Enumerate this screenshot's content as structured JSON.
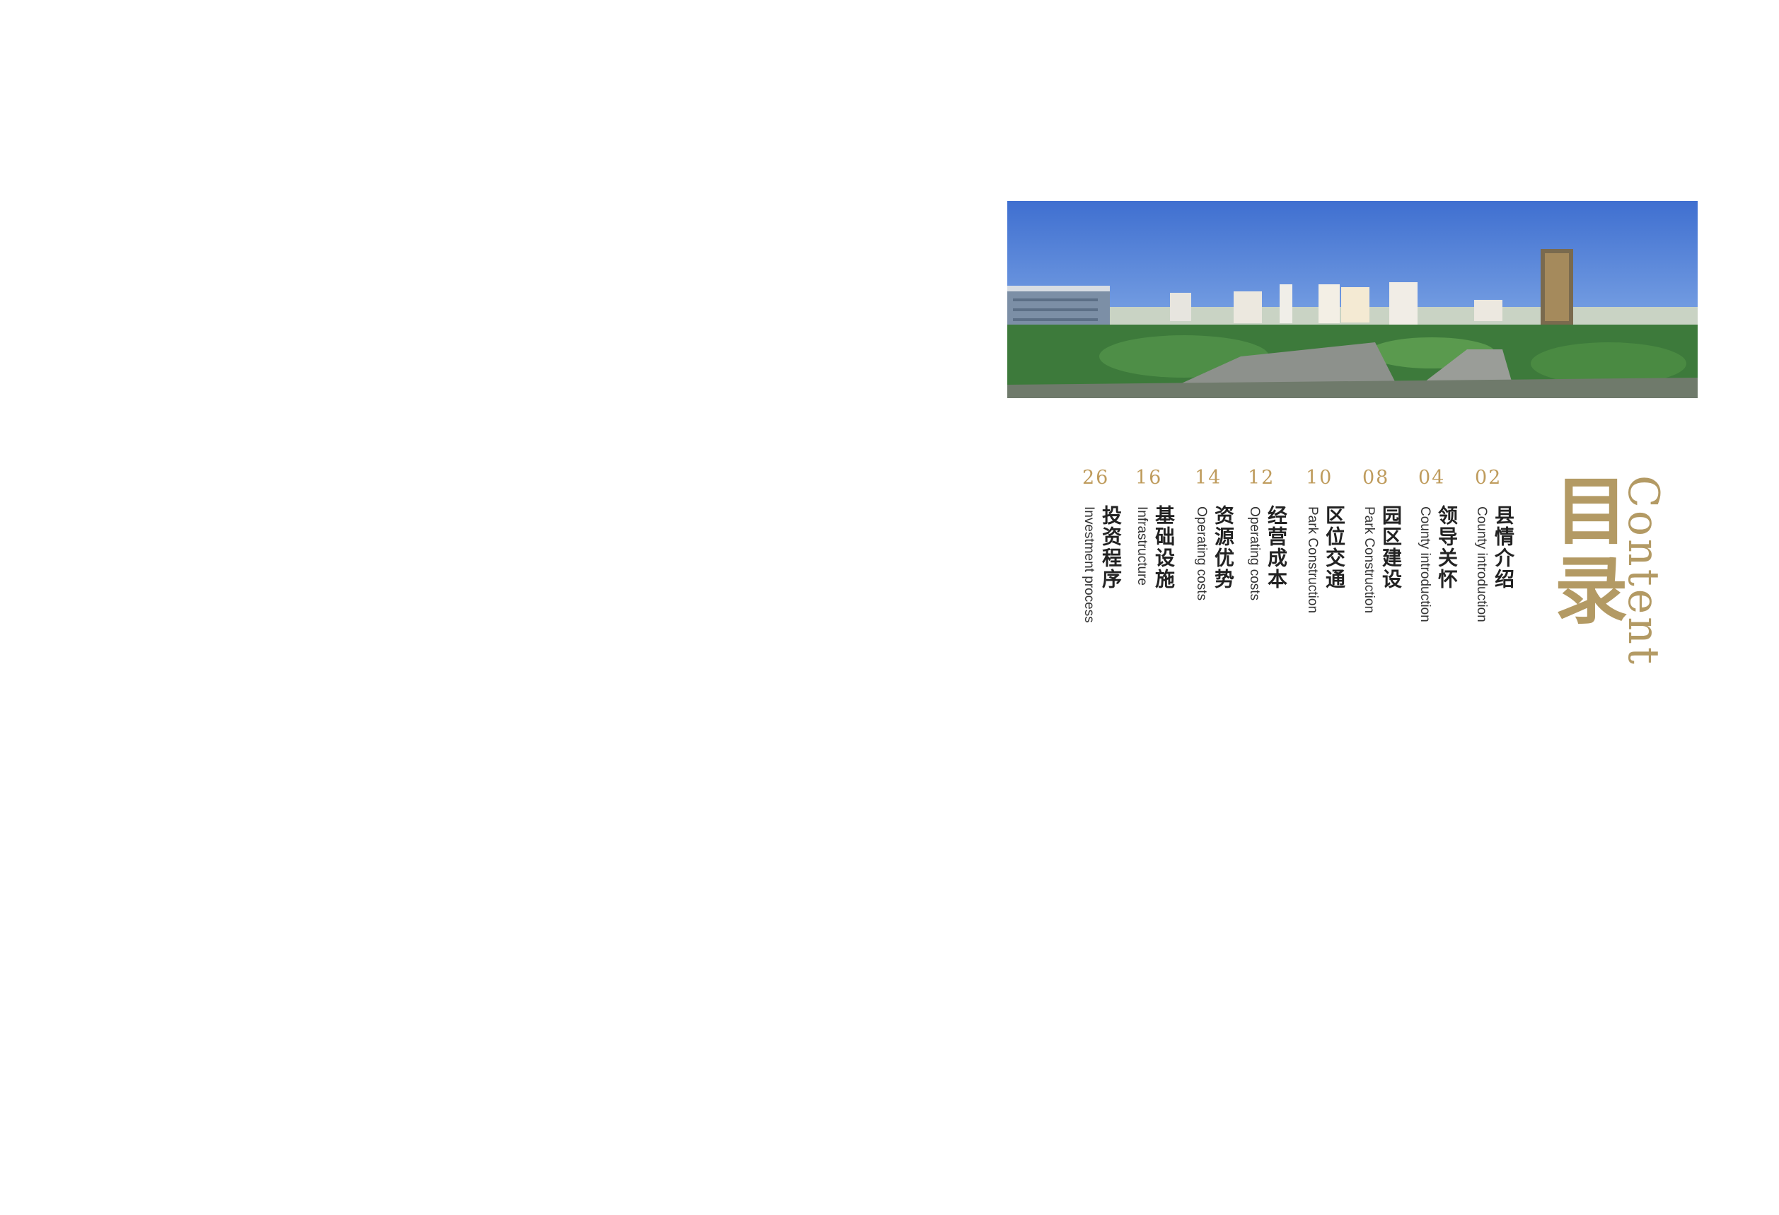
{
  "title": {
    "chinese": "目录",
    "english": "Content"
  },
  "photo": {
    "icon": "city-panorama-photo"
  },
  "toc": [
    {
      "page": "02",
      "title_cn": "县情介绍",
      "title_en": "County introduction"
    },
    {
      "page": "04",
      "title_cn": "领导关怀",
      "title_en": "County introduction"
    },
    {
      "page": "08",
      "title_cn": "园区建设",
      "title_en": "Park Construction"
    },
    {
      "page": "10",
      "title_cn": "区位交通",
      "title_en": "Park Construction"
    },
    {
      "page": "12",
      "title_cn": "经营成本",
      "title_en": "Operating costs"
    },
    {
      "page": "14",
      "title_cn": "资源优势",
      "title_en": "Operating costs"
    },
    {
      "page": "16",
      "title_cn": "基础设施",
      "title_en": "Infrastructure"
    },
    {
      "page": "26",
      "title_cn": "投资程序",
      "title_en": "Investment process"
    }
  ],
  "colors": {
    "accent": "#b39a64",
    "text": "#222222",
    "sky": "#5b86d8"
  }
}
